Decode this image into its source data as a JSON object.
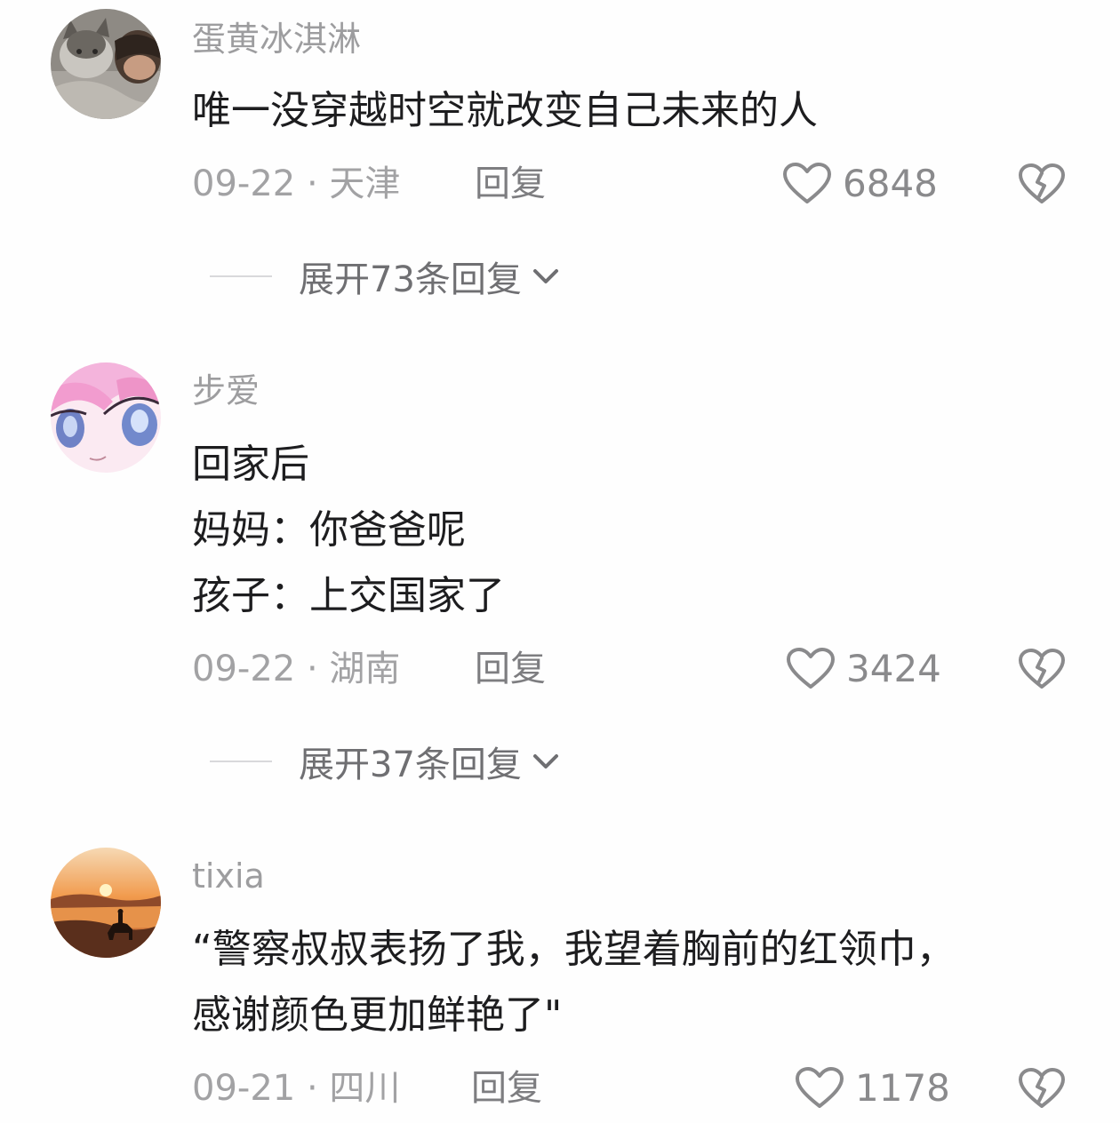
{
  "comments": [
    {
      "username": "蛋黄冰淇淋",
      "lines": [
        "唯一没穿越时空就改变自己未来的人"
      ],
      "date_location": "09-22 · 天津",
      "reply_label": "回复",
      "likes": "6848",
      "expand_label": "展开73条回复",
      "avatar_icon": "cat-photo-avatar"
    },
    {
      "username": "步爱",
      "lines": [
        "回家后",
        "妈妈：你爸爸呢",
        "孩子：上交国家了"
      ],
      "date_location": "09-22 · 湖南",
      "reply_label": "回复",
      "likes": "3424",
      "expand_label": "展开37条回复",
      "avatar_icon": "anime-face-avatar"
    },
    {
      "username": "tixia",
      "lines": [
        "“警察叔叔表扬了我，我望着胸前的红领巾，",
        "感谢颜色更加鲜艳了\""
      ],
      "date_location": "09-21 · 四川",
      "reply_label": "回复",
      "likes": "1178",
      "avatar_icon": "sunset-rider-avatar"
    }
  ],
  "colors": {
    "username": "#9d9d9f",
    "body": "#1d1d1f",
    "meta": "#a2a2a4",
    "icon": "#8a8a8c"
  }
}
